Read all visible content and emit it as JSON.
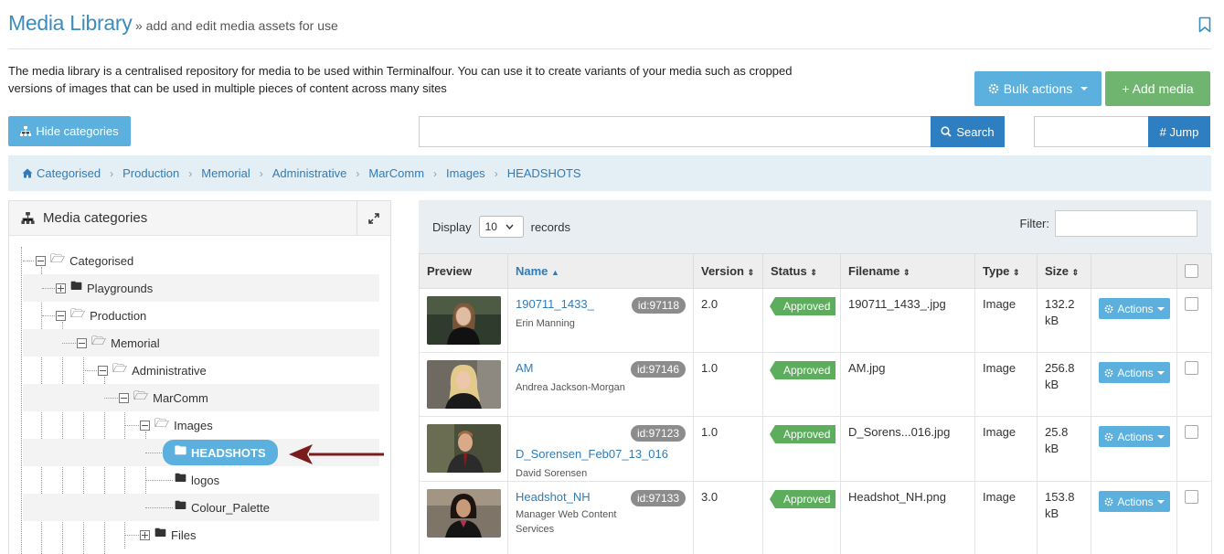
{
  "header": {
    "title": "Media Library",
    "subtitle": "» add and edit media assets for use",
    "bookmark_icon": "bookmark-icon"
  },
  "intro": "The media library is a centralised repository for media to be used within Terminalfour. You can use it to create variants of your media such as cropped versions of images that can be used in multiple pieces of content across many sites",
  "toolbar": {
    "bulk_actions": "Bulk actions",
    "add_media": "+ Add media",
    "hide_categories": "Hide categories",
    "search": "Search",
    "search_placeholder": "",
    "jump": "# Jump"
  },
  "breadcrumb": [
    "Categorised",
    "Production",
    "Memorial",
    "Administrative",
    "MarComm",
    "Images",
    "HEADSHOTS"
  ],
  "categories": {
    "title": "Media categories",
    "tree": [
      {
        "label": "Categorised",
        "expanded": true
      },
      {
        "label": "Playgrounds",
        "expanded": false
      },
      {
        "label": "Production",
        "expanded": true
      },
      {
        "label": "Memorial",
        "expanded": true
      },
      {
        "label": "Administrative",
        "expanded": true
      },
      {
        "label": "MarComm",
        "expanded": true
      },
      {
        "label": "Images",
        "expanded": true
      },
      {
        "label": "HEADSHOTS",
        "selected": true
      },
      {
        "label": "logos"
      },
      {
        "label": "Colour_Palette"
      },
      {
        "label": "Files",
        "expanded": false
      }
    ]
  },
  "table": {
    "display_label": "Display",
    "display_value": "10",
    "records_label": "records",
    "filter_label": "Filter:",
    "columns": [
      "Preview",
      "Name",
      "Version",
      "Status",
      "Filename",
      "Type",
      "Size",
      "",
      ""
    ],
    "rows": [
      {
        "name": "190711_1433_",
        "author": "Erin Manning",
        "id": "id:97118",
        "version": "2.0",
        "status": "Approved",
        "filename": "190711_1433_.jpg",
        "type": "Image",
        "size": "132.2 kB",
        "actions": "Actions"
      },
      {
        "name": "AM",
        "author": "Andrea Jackson-Morgan",
        "id": "id:97146",
        "version": "1.0",
        "status": "Approved",
        "filename": "AM.jpg",
        "type": "Image",
        "size": "256.8 kB",
        "actions": "Actions"
      },
      {
        "name": "D_Sorensen_Feb07_13_016",
        "author": "David Sorensen",
        "id": "id:97123",
        "version": "1.0",
        "status": "Approved",
        "filename": "D_Sorens...016.jpg",
        "type": "Image",
        "size": "25.8 kB",
        "actions": "Actions"
      },
      {
        "name": "Headshot_NH",
        "author": "Manager Web Content Services",
        "id": "id:97133",
        "version": "3.0",
        "status": "Approved",
        "filename": "Headshot_NH.png",
        "type": "Image",
        "size": "153.8 kB",
        "actions": "Actions"
      }
    ]
  },
  "colors": {
    "accent": "#5bb0dd",
    "primary": "#2d7fc1",
    "success": "#6fb56f",
    "link": "#2f7cb9",
    "arrow": "#7a1c1c"
  }
}
